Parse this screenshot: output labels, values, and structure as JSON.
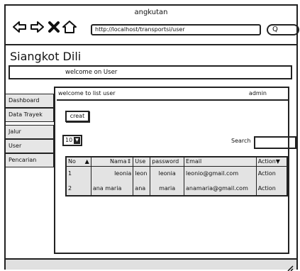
{
  "window": {
    "title": "angkutan"
  },
  "browser": {
    "url": "http://localhost/transportsi/user",
    "search_glyph": "Q"
  },
  "app": {
    "brand": "Siangkot Dili",
    "welcome": "welcome on User"
  },
  "sidebar": {
    "items": [
      {
        "label": "Dashboard"
      },
      {
        "label": "Data Trayek"
      },
      {
        "label": "Jalur"
      },
      {
        "label": "User"
      },
      {
        "label": "Pencarian"
      }
    ]
  },
  "panel": {
    "title": "welcome to list user",
    "user": "admin",
    "create_label": "creat",
    "entries_value": "10",
    "search_label": "Search"
  },
  "table": {
    "headers": [
      "No",
      "Nama",
      "Use",
      "password",
      "Email",
      "Action"
    ],
    "rows": [
      {
        "no": "1",
        "nama": "leonia",
        "user": "leon",
        "password": "leonia",
        "email": "leonio@gmail.com",
        "action": "Action"
      },
      {
        "no": "2",
        "nama": "ana maria",
        "user": "ana",
        "password": "maria",
        "email": "anamaria@gmail.com",
        "action": "Action"
      }
    ]
  },
  "icons": [
    "back-arrow-icon",
    "forward-arrow-icon",
    "close-icon",
    "home-icon",
    "search-icon",
    "sort-asc-icon",
    "sort-icon",
    "sort-desc-icon",
    "resize-grip-icon"
  ]
}
